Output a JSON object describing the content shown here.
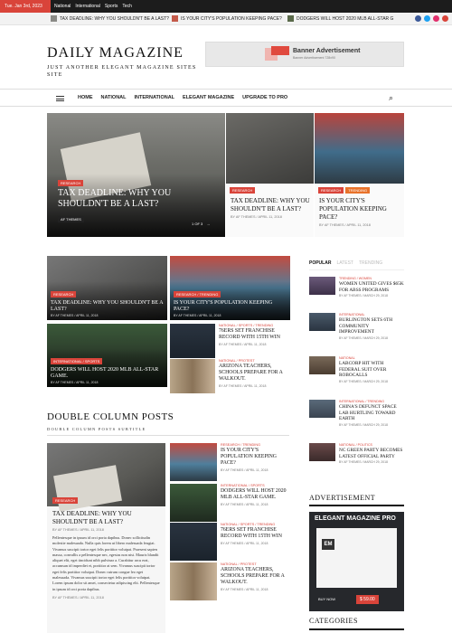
{
  "topbar": {
    "date": "Tue. Jan 3rd, 2023",
    "nav": [
      "National",
      "International",
      "Sports",
      "Tech"
    ]
  },
  "ticker": {
    "items": [
      "TAX DEADLINE: WHY YOU SHOULDN'T BE A LAST?",
      "IS YOUR CITY'S POPULATION KEEPING PACE?",
      "DODGERS WILL HOST 2020 MLB ALL-STAR G"
    ],
    "social_colors": [
      "#3b5998",
      "#1da1f2",
      "#e1306c",
      "#d9443a"
    ]
  },
  "brand": {
    "name": "DAILY MAGAZINE",
    "tagline": "JUST ANOTHER ELEGANT MAGAZINE SITES SITE"
  },
  "banner": {
    "title": "Banner Advertisement",
    "subtitle": "Banner Advertisement 728x90"
  },
  "nav": {
    "items": [
      "HOME",
      "NATIONAL",
      "INTERNATIONAL",
      "ELEGANT MAGAZINE",
      "UPGRADE TO PRO"
    ]
  },
  "slider": {
    "badge": "RESEARCH",
    "title": "TAX DEADLINE: WHY YOU SHOULDN'T BE A LAST?",
    "author": "AF THEMES",
    "pager": "1 OF 3"
  },
  "featured": [
    {
      "cats": [
        "RESEARCH"
      ],
      "title": "TAX DEADLINE: WHY YOU SHOULDN'T BE A LAST?",
      "meta": "BY AF THEMES / APRIL 11, 2018"
    },
    {
      "cats": [
        "RESEARCH",
        "TRENDING"
      ],
      "title": "IS YOUR CITY'S POPULATION KEEPING PACE?",
      "meta": "BY AF THEMES / APRIL 11, 2018"
    }
  ],
  "grid": [
    {
      "cats": "RESEARCH",
      "title": "TAX DEADLINE: WHY YOU SHOULDN'T BE A LAST?",
      "meta": "BY AF THEMES / APRIL 11, 2018"
    },
    {
      "cats": "RESEARCH / TRENDING",
      "title": "IS YOUR CITY'S POPULATION KEEPING PACE?",
      "meta": "BY AF THEMES / APRIL 11, 2018"
    },
    {
      "cats": "INTERNATIONAL / SPORTS",
      "title": "DODGERS WILL HOST 2020 MLB ALL-STAR GAME.",
      "meta": "BY AF THEMES / APRIL 11, 2018"
    }
  ],
  "grid_list": [
    {
      "cats": "NATIONAL / SPORTS / TRENDING",
      "title": "76ERS SET FRANCHISE RECORD WITH 15TH WIN",
      "meta": "BY AF THEMES / APRIL 11, 2018"
    },
    {
      "cats": "NATIONAL / PROTEST",
      "title": "ARIZONA TEACHERS, SCHOOLS PREPARE FOR A WALKOUT.",
      "meta": "BY AF THEMES / APRIL 11, 2018"
    }
  ],
  "double": {
    "heading": "DOUBLE COLUMN POSTS",
    "subtitle": "DOUBLE COLUMN POSTS SUBTITLE",
    "big": {
      "badge": "RESEARCH",
      "title": "TAX DEADLINE: WHY YOU SHOULDN'T BE A LAST?",
      "meta": "BY AF THEMES / APRIL 11, 2018",
      "excerpt": "Pellentesque in ipsum id orci porta dapibus. Donec sollicitudin molestie malesuada. Nulla quis lorem ut libero malesuada feugiat. Vivamus suscipit tortor eget felis porttitor volutpat. Praesent sapien massa, convallis a pellentesque nec, egestas non nisi. Mauris blandit aliquet elit, eget tincidunt nibh pulvinar a. Curabitur arcu erat, accumsan id imperdiet et, porttitor at sem. Vivamus suscipit tortor eget felis porttitor volutpat. Donec rutrum congue leo eget malesuada. Vivamus suscipit tortor eget felis porttitor volutpat. Lorem ipsum dolor sit amet, consectetur adipiscing elit. Pellentesque in ipsum id orci porta dapibus.",
      "footer": "BY AF THEMES / APRIL 11, 2018"
    },
    "list": [
      {
        "cats": "RESEARCH / TRENDING",
        "title": "IS YOUR CITY'S POPULATION KEEPING PACE?",
        "meta": "BY AF THEMES / APRIL 11, 2018"
      },
      {
        "cats": "INTERNATIONAL / SPORTS",
        "title": "DODGERS WILL HOST 2020 MLB ALL-STAR GAME.",
        "meta": "BY AF THEMES / APRIL 11, 2018"
      },
      {
        "cats": "NATIONAL / SPORTS / TRENDING",
        "title": "76ERS SET FRANCHISE RECORD WITH 15TH WIN",
        "meta": "BY AF THEMES / APRIL 11, 2018"
      },
      {
        "cats": "NATIONAL / PROTEST",
        "title": "ARIZONA TEACHERS, SCHOOLS PREPARE FOR A WALKOUT.",
        "meta": "BY AF THEMES / APRIL 11, 2018"
      }
    ]
  },
  "sidebar": {
    "tabs": [
      "POPULAR",
      "LATEST",
      "TRENDING"
    ],
    "items": [
      {
        "cats": "TRENDING / WOMEN",
        "title": "WOMEN UNITED GIVES $65K FOR ABSS PROGRAMS",
        "meta": "BY AF THEMES / MARCH 29, 2018"
      },
      {
        "cats": "INTERNATIONAL",
        "title": "BURLINGTON SETS 6TH COMMUNITY IMPROVEMENT",
        "meta": "BY AF THEMES / MARCH 29, 2018"
      },
      {
        "cats": "NATIONAL",
        "title": "LABCORP HIT WITH FEDERAL SUIT OVER ROBOCALLS",
        "meta": "BY AF THEMES / MARCH 29, 2018"
      },
      {
        "cats": "INTERNATIONAL / TRENDING",
        "title": "CHINA'S DEFUNCT SPACE LAB HURTLING TOWARD EARTH",
        "meta": "BY AF THEMES / MARCH 29, 2018"
      },
      {
        "cats": "NATIONAL / POLITICS",
        "title": "NC GREEN PARTY BECOMES LATEST OFFICIAL PARTY",
        "meta": "BY AF THEMES / MARCH 29, 2018"
      }
    ],
    "ad_heading": "ADVERTISEMENT",
    "ad": {
      "title": "ELEGANT MAGAZINE PRO",
      "logo": "EM",
      "buy": "BUY NOW",
      "price": "$ 59.00"
    },
    "categories_heading": "CATEGORIES"
  },
  "colors": {
    "accent": "#d9443a",
    "dark": "#1c1c1c"
  }
}
